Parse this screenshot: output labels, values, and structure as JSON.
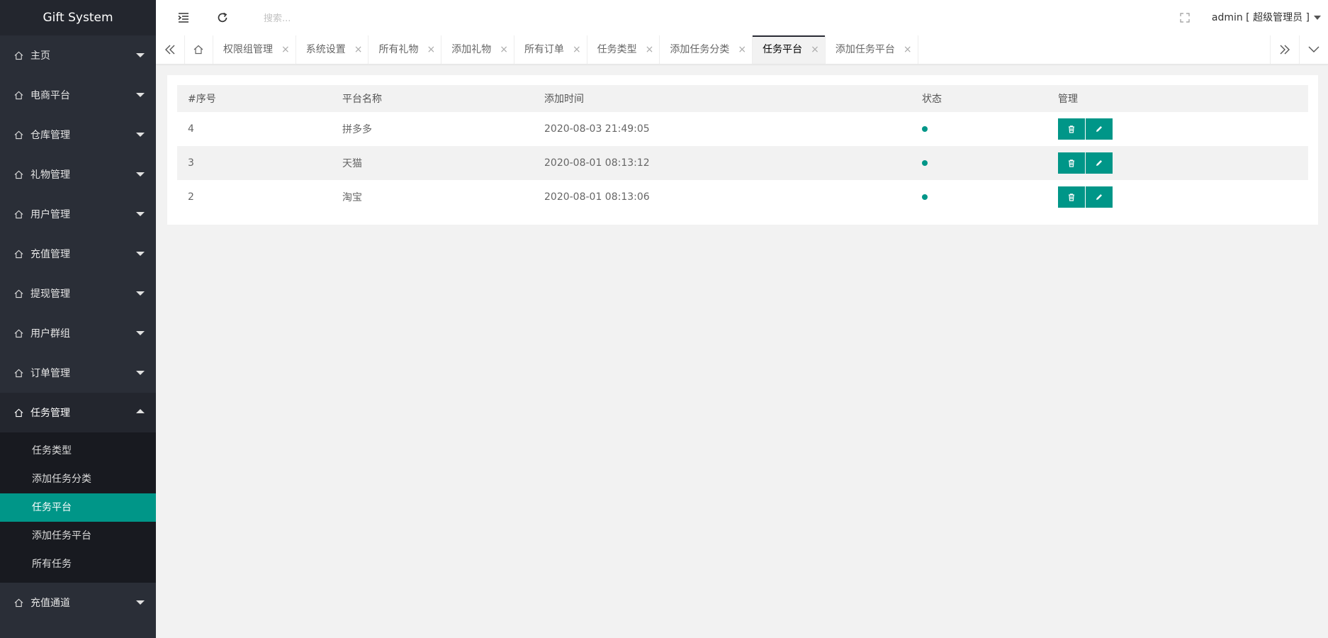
{
  "app": {
    "title": "Gift System"
  },
  "sidebar": {
    "items": [
      {
        "label": "主页"
      },
      {
        "label": "电商平台"
      },
      {
        "label": "仓库管理"
      },
      {
        "label": "礼物管理"
      },
      {
        "label": "用户管理"
      },
      {
        "label": "充值管理"
      },
      {
        "label": "提现管理"
      },
      {
        "label": "用户群组"
      },
      {
        "label": "订单管理"
      },
      {
        "label": "任务管理",
        "expanded": true
      }
    ],
    "sub_items": [
      {
        "label": "任务类型"
      },
      {
        "label": "添加任务分类"
      },
      {
        "label": "任务平台",
        "active": true
      },
      {
        "label": "添加任务平台"
      },
      {
        "label": "所有任务"
      }
    ],
    "after_items": [
      {
        "label": "充值通道"
      }
    ]
  },
  "header": {
    "search_placeholder": "搜索...",
    "user_label": "admin [ 超级管理员 ]"
  },
  "tabs": [
    {
      "label": "权限组管理"
    },
    {
      "label": "系统设置"
    },
    {
      "label": "所有礼物"
    },
    {
      "label": "添加礼物"
    },
    {
      "label": "所有订单"
    },
    {
      "label": "任务类型"
    },
    {
      "label": "添加任务分类"
    },
    {
      "label": "任务平台",
      "active": true
    },
    {
      "label": "添加任务平台"
    }
  ],
  "table": {
    "headers": [
      "#序号",
      "平台名称",
      "添加时间",
      "状态",
      "管理"
    ],
    "rows": [
      {
        "id": "4",
        "name": "拼多多",
        "time": "2020-08-03 21:49:05",
        "status": "active"
      },
      {
        "id": "3",
        "name": "天猫",
        "time": "2020-08-01 08:13:12",
        "status": "active"
      },
      {
        "id": "2",
        "name": "淘宝",
        "time": "2020-08-01 08:13:06",
        "status": "active"
      }
    ]
  },
  "colors": {
    "accent": "#009688",
    "sidebar_bg": "#2a2e37",
    "submenu_bg": "#181a20"
  },
  "icons": {
    "nav": "home-icon",
    "menu": "indent-icon",
    "refresh": "refresh-icon",
    "fullscreen": "fullscreen-icon",
    "delete": "trash-icon",
    "edit": "pencil-icon"
  }
}
